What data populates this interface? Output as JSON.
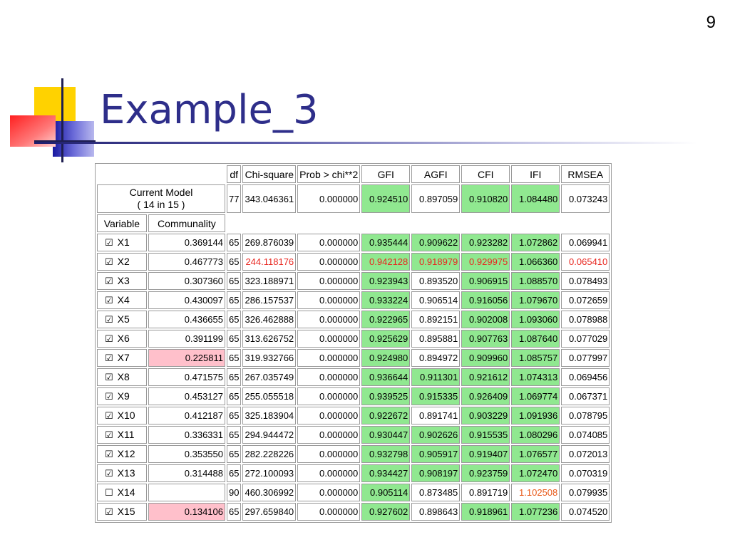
{
  "slide": {
    "number": "9",
    "title": "Example_3"
  },
  "table": {
    "headers": [
      "df",
      "Chi-square",
      "Prob > chi**2",
      "GFI",
      "AGFI",
      "CFI",
      "IFI",
      "RMSEA"
    ],
    "current_model": {
      "label_line1": "Current Model",
      "label_line2": "( 14 in 15 )",
      "df": "77",
      "chisq": "343.046361",
      "prob": "0.000000",
      "gfi": "0.924510",
      "agfi": "0.897059",
      "cfi": "0.910820",
      "ifi": "1.084480",
      "rmsea": "0.073243"
    },
    "sub_headers": [
      "Variable",
      "Communality"
    ],
    "checkbox_checked": "☑",
    "checkbox_unchecked": "☐",
    "rows": [
      {
        "var": "X1",
        "checked": true,
        "comm": "0.369144",
        "df": "65",
        "chisq": "269.876039",
        "prob": "0.000000",
        "gfi": "0.935444",
        "agfi": "0.909622",
        "cfi": "0.923282",
        "ifi": "1.072862",
        "rmsea": "0.069941"
      },
      {
        "var": "X2",
        "checked": true,
        "comm": "0.467773",
        "df": "65",
        "chisq": "244.118176",
        "prob": "0.000000",
        "gfi": "0.942128",
        "agfi": "0.918979",
        "cfi": "0.929975",
        "ifi": "1.066360",
        "rmsea": "0.065410"
      },
      {
        "var": "X3",
        "checked": true,
        "comm": "0.307360",
        "df": "65",
        "chisq": "323.188971",
        "prob": "0.000000",
        "gfi": "0.923943",
        "agfi": "0.893520",
        "cfi": "0.906915",
        "ifi": "1.088570",
        "rmsea": "0.078493"
      },
      {
        "var": "X4",
        "checked": true,
        "comm": "0.430097",
        "df": "65",
        "chisq": "286.157537",
        "prob": "0.000000",
        "gfi": "0.933224",
        "agfi": "0.906514",
        "cfi": "0.916056",
        "ifi": "1.079670",
        "rmsea": "0.072659"
      },
      {
        "var": "X5",
        "checked": true,
        "comm": "0.436655",
        "df": "65",
        "chisq": "326.462888",
        "prob": "0.000000",
        "gfi": "0.922965",
        "agfi": "0.892151",
        "cfi": "0.902008",
        "ifi": "1.093060",
        "rmsea": "0.078988"
      },
      {
        "var": "X6",
        "checked": true,
        "comm": "0.391199",
        "df": "65",
        "chisq": "313.626752",
        "prob": "0.000000",
        "gfi": "0.925629",
        "agfi": "0.895881",
        "cfi": "0.907763",
        "ifi": "1.087640",
        "rmsea": "0.077029"
      },
      {
        "var": "X7",
        "checked": true,
        "comm": "0.225811",
        "df": "65",
        "chisq": "319.932766",
        "prob": "0.000000",
        "gfi": "0.924980",
        "agfi": "0.894972",
        "cfi": "0.909960",
        "ifi": "1.085757",
        "rmsea": "0.077997"
      },
      {
        "var": "X8",
        "checked": true,
        "comm": "0.471575",
        "df": "65",
        "chisq": "267.035749",
        "prob": "0.000000",
        "gfi": "0.936644",
        "agfi": "0.911301",
        "cfi": "0.921612",
        "ifi": "1.074313",
        "rmsea": "0.069456"
      },
      {
        "var": "X9",
        "checked": true,
        "comm": "0.453127",
        "df": "65",
        "chisq": "255.055518",
        "prob": "0.000000",
        "gfi": "0.939525",
        "agfi": "0.915335",
        "cfi": "0.926409",
        "ifi": "1.069774",
        "rmsea": "0.067371"
      },
      {
        "var": "X10",
        "checked": true,
        "comm": "0.412187",
        "df": "65",
        "chisq": "325.183904",
        "prob": "0.000000",
        "gfi": "0.922672",
        "agfi": "0.891741",
        "cfi": "0.903229",
        "ifi": "1.091936",
        "rmsea": "0.078795"
      },
      {
        "var": "X11",
        "checked": true,
        "comm": "0.336331",
        "df": "65",
        "chisq": "294.944472",
        "prob": "0.000000",
        "gfi": "0.930447",
        "agfi": "0.902626",
        "cfi": "0.915535",
        "ifi": "1.080296",
        "rmsea": "0.074085"
      },
      {
        "var": "X12",
        "checked": true,
        "comm": "0.353550",
        "df": "65",
        "chisq": "282.228226",
        "prob": "0.000000",
        "gfi": "0.932798",
        "agfi": "0.905917",
        "cfi": "0.919407",
        "ifi": "1.076577",
        "rmsea": "0.072013"
      },
      {
        "var": "X13",
        "checked": true,
        "comm": "0.314488",
        "df": "65",
        "chisq": "272.100093",
        "prob": "0.000000",
        "gfi": "0.934427",
        "agfi": "0.908197",
        "cfi": "0.923759",
        "ifi": "1.072470",
        "rmsea": "0.070319"
      },
      {
        "var": "X14",
        "checked": false,
        "comm": "",
        "df": "90",
        "chisq": "460.306992",
        "prob": "0.000000",
        "gfi": "0.905114",
        "agfi": "0.873485",
        "cfi": "0.891719",
        "ifi": "1.102508",
        "rmsea": "0.079935"
      },
      {
        "var": "X15",
        "checked": true,
        "comm": "0.134106",
        "df": "65",
        "chisq": "297.659840",
        "prob": "0.000000",
        "gfi": "0.927602",
        "agfi": "0.898643",
        "cfi": "0.918961",
        "ifi": "1.077236",
        "rmsea": "0.074520"
      }
    ]
  },
  "colors": {
    "title": "#2e2e8a",
    "green_highlight": "#90e890",
    "pink_highlight": "#ffc0cb",
    "red_text": "#e8261f",
    "orange_text": "#e85a1a",
    "deco_yellow": "#ffd200",
    "deco_red": "#ff3838",
    "deco_blue": "#2a2ab8"
  }
}
